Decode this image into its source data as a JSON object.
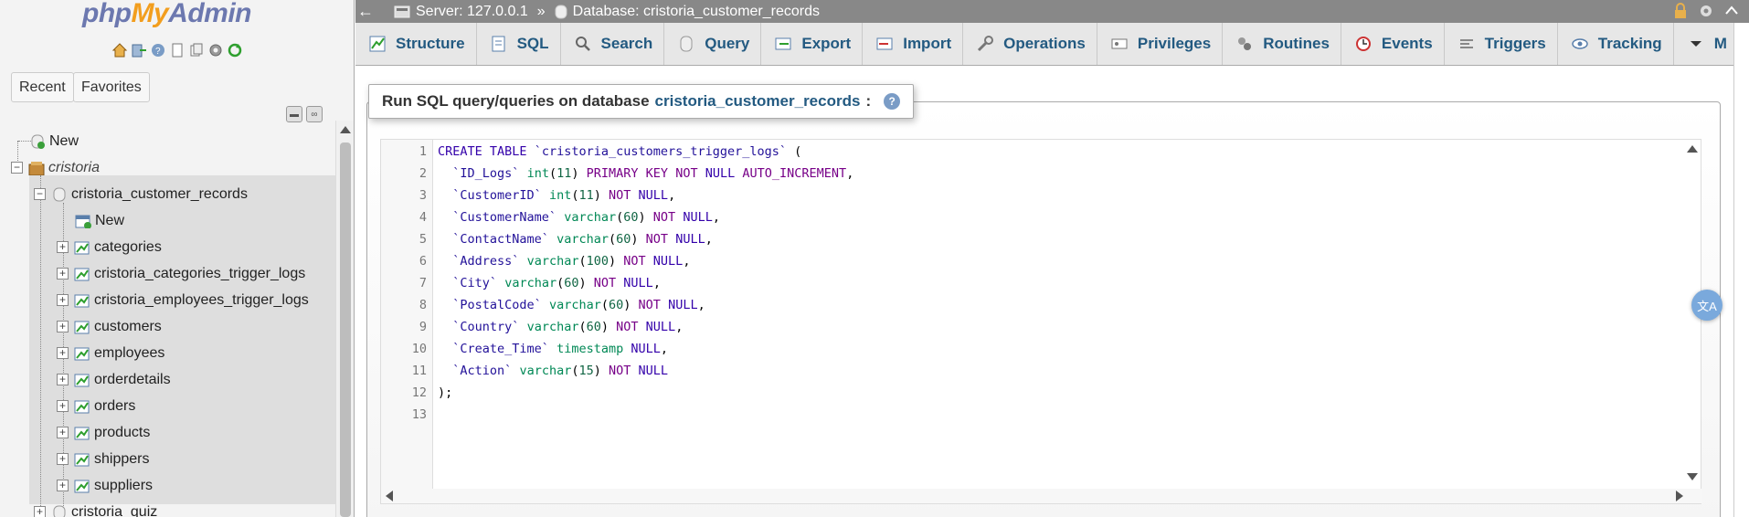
{
  "app": {
    "logo_php": "php",
    "logo_my": "My",
    "logo_admin": "Admin"
  },
  "nav": {
    "recent_label": "Recent",
    "favorites_label": "Favorites",
    "tree": {
      "new_label": "New",
      "server_group": "cristoria",
      "db_name": "cristoria_customer_records",
      "db_new_label": "New",
      "tables": [
        "categories",
        "cristoria_categories_trigger_logs",
        "cristoria_employees_trigger_logs",
        "customers",
        "employees",
        "orderdetails",
        "orders",
        "products",
        "shippers",
        "suppliers"
      ],
      "next_db": "cristoria_quiz"
    }
  },
  "topbar": {
    "server_label": "Server: 127.0.0.1",
    "separator": "»",
    "database_label": "Database: cristoria_customer_records"
  },
  "tabs": [
    {
      "label": "Structure",
      "icon": "structure-icon"
    },
    {
      "label": "SQL",
      "icon": "sql-icon"
    },
    {
      "label": "Search",
      "icon": "search-icon"
    },
    {
      "label": "Query",
      "icon": "query-icon"
    },
    {
      "label": "Export",
      "icon": "export-icon"
    },
    {
      "label": "Import",
      "icon": "import-icon"
    },
    {
      "label": "Operations",
      "icon": "operations-icon"
    },
    {
      "label": "Privileges",
      "icon": "privileges-icon"
    },
    {
      "label": "Routines",
      "icon": "routines-icon"
    },
    {
      "label": "Events",
      "icon": "events-icon"
    },
    {
      "label": "Triggers",
      "icon": "triggers-icon"
    },
    {
      "label": "Tracking",
      "icon": "tracking-icon"
    },
    {
      "label": "M",
      "icon": "more-icon"
    }
  ],
  "sql_panel": {
    "legend_prefix": "Run SQL query/queries on database",
    "legend_db": "cristoria_customer_records",
    "legend_suffix": ":"
  },
  "editor": {
    "line_numbers": [
      "1",
      "2",
      "3",
      "4",
      "5",
      "6",
      "7",
      "8",
      "9",
      "10",
      "11",
      "12",
      "13"
    ]
  },
  "colors": {
    "link_blue": "#235a81",
    "sql_keyword": "#770088",
    "sql_type": "#008855",
    "sql_number": "#116644",
    "sql_identifier": "#221199",
    "logo_blue": "#6c78af",
    "logo_orange": "#f29e1e"
  }
}
